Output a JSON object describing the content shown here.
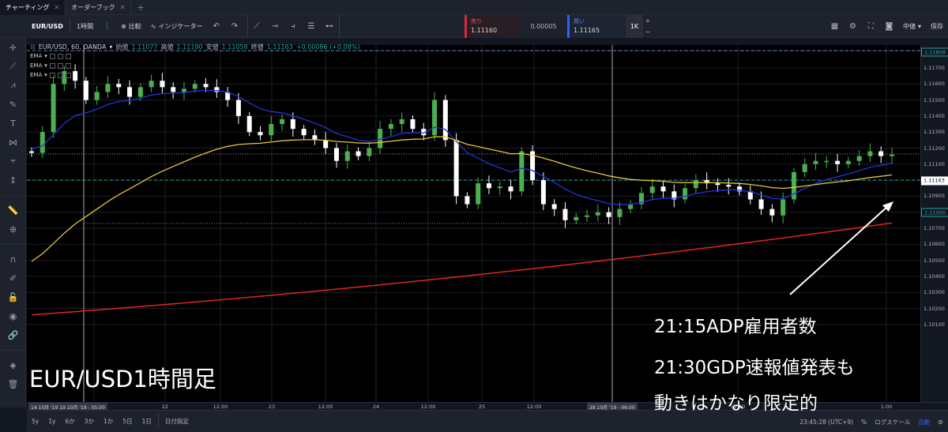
{
  "tabs": [
    {
      "label": "チャーティング",
      "active": true
    },
    {
      "label": "オーダーブック",
      "active": false
    }
  ],
  "toolbar": {
    "symbol": "EUR/USD",
    "interval": "1時間",
    "compare_label": "比較",
    "indicator_label": "インジケーター",
    "mid_label": "中値",
    "save_label": "保存"
  },
  "trade": {
    "sell_label": "売り",
    "sell_price": "1.11160",
    "spread": "0.00005",
    "buy_label": "買い",
    "buy_price": "1.11165",
    "quantity": "1K",
    "plus": "+",
    "minus": "−"
  },
  "legend": {
    "title": "EUR/USD, 60, OANDA",
    "open_label": "始値",
    "open": "1.11077",
    "high_label": "高値",
    "high": "1.11190",
    "low_label": "安値",
    "low": "1.11058",
    "close_label": "終値",
    "close": "1.11163",
    "change": "+0.00086 (+0.08%)",
    "ema": [
      "EMA",
      "EMA",
      "EMA"
    ]
  },
  "price_scale": {
    "ticks": [
      "1.11700",
      "1.11600",
      "1.11500",
      "1.11400",
      "1.11300",
      "1.11200",
      "1.11100",
      "1.11000",
      "1.10900",
      "1.10800",
      "1.10700",
      "1.10600",
      "1.10500",
      "1.10400",
      "1.10300",
      "1.10200",
      "1.10100"
    ],
    "badge_top": "1.11808",
    "badge_current": "1.11163",
    "badge_level": "1.11000"
  },
  "time_axis": {
    "ticks": [
      "12:00",
      "22",
      "12:00",
      "23",
      "12:00",
      "24",
      "12:00",
      "25",
      "12:00",
      "12:00",
      "1:00"
    ],
    "cursor_left": "14 10月 '19  19 10月 '19 - 05:00",
    "cursor_mid": "28 10月 '19 - 06:00"
  },
  "bottom": {
    "ranges": [
      "5y",
      "1y",
      "6か",
      "3か",
      "1か",
      "5日",
      "1日"
    ],
    "date_range": "日付指定",
    "clock": "23:45:28 (UTC+9)",
    "pct": "%",
    "log": "ログスケール",
    "auto": "自動"
  },
  "overlay": {
    "title": "EUR/USD1時間足",
    "note1": "21:15ADP雇用者数",
    "note2": "21:30GDP速報値発表も",
    "note3": "動きはかなり限定的"
  },
  "colors": {
    "bg": "#131722",
    "up": "#4caf50",
    "down": "#ffffff",
    "ema_fast": "#2134d8",
    "ema_mid": "#e6c635",
    "ema_slow": "#e0251f",
    "dashed_level": "#26a69a",
    "magenta": "#c04dd8"
  },
  "chart_data": {
    "type": "candlestick",
    "ylim": [
      1.1005,
      1.1185
    ],
    "close_series": [
      1.1117,
      1.113,
      1.116,
      1.1168,
      1.1162,
      1.115,
      1.1155,
      1.116,
      1.1158,
      1.1152,
      1.1158,
      1.1162,
      1.1158,
      1.1155,
      1.1157,
      1.116,
      1.1158,
      1.1155,
      1.115,
      1.114,
      1.113,
      1.1128,
      1.1135,
      1.1138,
      1.1132,
      1.1128,
      1.1125,
      1.112,
      1.1112,
      1.1118,
      1.1115,
      1.112,
      1.1132,
      1.1135,
      1.1138,
      1.1132,
      1.1128,
      1.115,
      1.1125,
      1.109,
      1.1085,
      1.1098,
      1.1095,
      1.1096,
      1.1093,
      1.1118,
      1.11,
      1.1085,
      1.1082,
      1.1075,
      1.1077,
      1.1078,
      1.108,
      1.1077,
      1.1082,
      1.1085,
      1.1092,
      1.1096,
      1.1093,
      1.1088,
      1.1095,
      1.11,
      1.1098,
      1.1097,
      1.1096,
      1.1093,
      1.1088,
      1.1082,
      1.1078,
      1.1088,
      1.1105,
      1.111,
      1.1112,
      1.1112,
      1.111,
      1.1112,
      1.1115,
      1.1118,
      1.1115,
      1.1116
    ]
  }
}
